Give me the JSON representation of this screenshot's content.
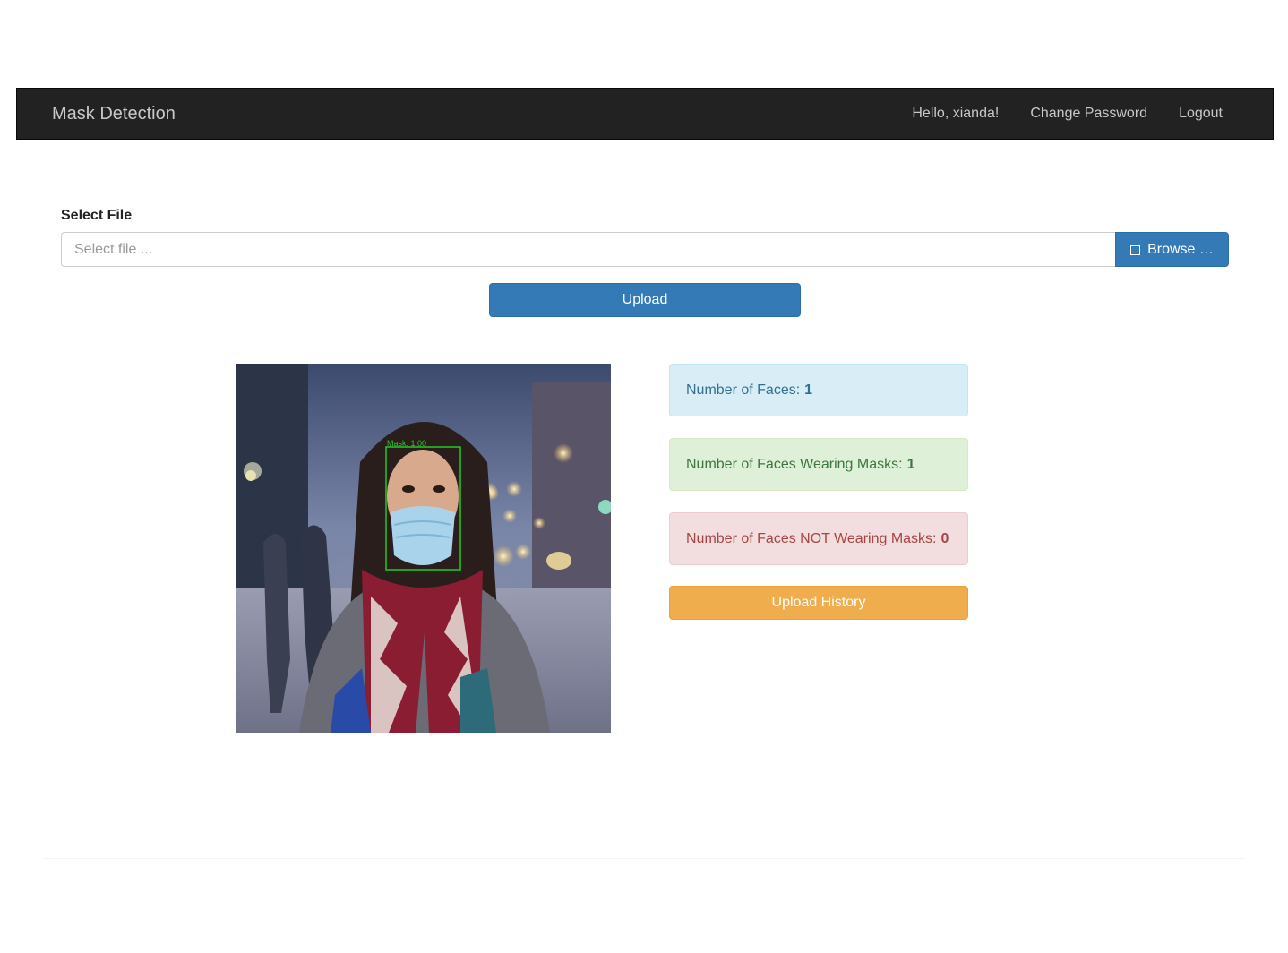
{
  "navbar": {
    "brand": "Mask Detection",
    "greeting": "Hello, xianda!",
    "change_password": "Change Password",
    "logout": "Logout"
  },
  "upload_form": {
    "label": "Select File",
    "placeholder": "Select file ...",
    "browse_label": "Browse …",
    "upload_label": "Upload"
  },
  "result_image": {
    "detection_label": "Mask: 1.00"
  },
  "stats": {
    "faces_label": "Number of Faces:",
    "faces_value": "1",
    "masked_label": "Number of Faces Wearing Masks:",
    "masked_value": "1",
    "unmasked_label": "Number of Faces NOT Wearing Masks:",
    "unmasked_value": "0",
    "history_label": "Upload History"
  },
  "colors": {
    "navbar_bg": "#222222",
    "primary": "#337ab7",
    "warning": "#f0ad4e",
    "info_bg": "#d9edf7",
    "success_bg": "#dff0d8",
    "danger_bg": "#f2dede",
    "detection_box": "#22cc22"
  }
}
